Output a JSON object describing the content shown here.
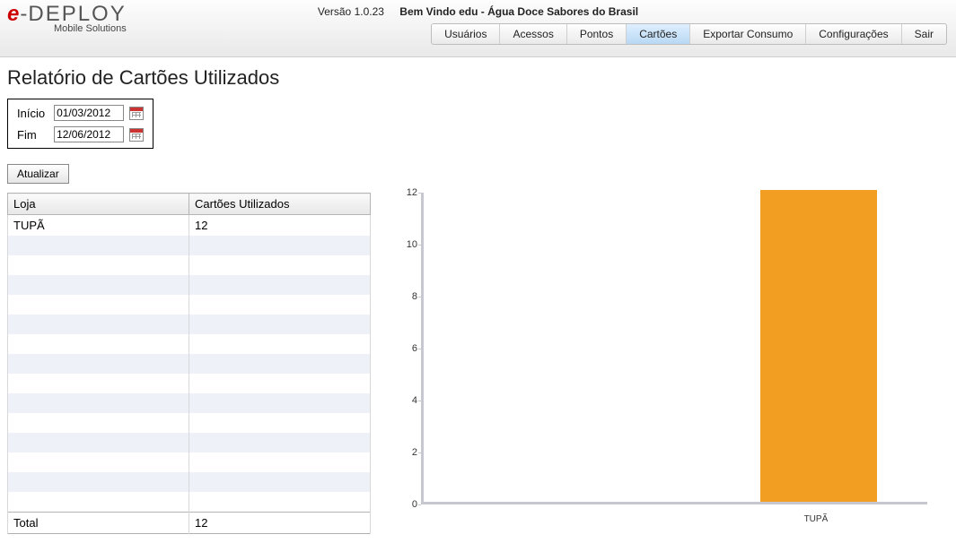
{
  "header": {
    "version": "Versão 1.0.23",
    "welcome": "Bem Vindo edu - Água Doce Sabores do Brasil",
    "nav": {
      "usuarios": "Usuários",
      "acessos": "Acessos",
      "pontos": "Pontos",
      "cartoes": "Cartões",
      "exportar": "Exportar Consumo",
      "config": "Configurações",
      "sair": "Sair"
    },
    "logo_sub": "Mobile Solutions"
  },
  "page": {
    "title": "Relatório de Cartões Utilizados",
    "labels": {
      "inicio": "Início",
      "fim": "Fim"
    },
    "dates": {
      "inicio": "01/03/2012",
      "fim": "12/06/2012"
    },
    "update_btn": "Atualizar"
  },
  "table": {
    "col1": "Loja",
    "col2": "Cartões Utilizados",
    "rows": [
      {
        "loja": "TUPÃ",
        "val": "12"
      }
    ],
    "total_label": "Total",
    "total_val": "12"
  },
  "chart_data": {
    "type": "bar",
    "categories": [
      "TUPÃ"
    ],
    "values": [
      12
    ],
    "ylim": [
      0,
      12
    ],
    "yticks": [
      0,
      2,
      4,
      6,
      8,
      10,
      12
    ],
    "bar_color": "#f19e22"
  }
}
